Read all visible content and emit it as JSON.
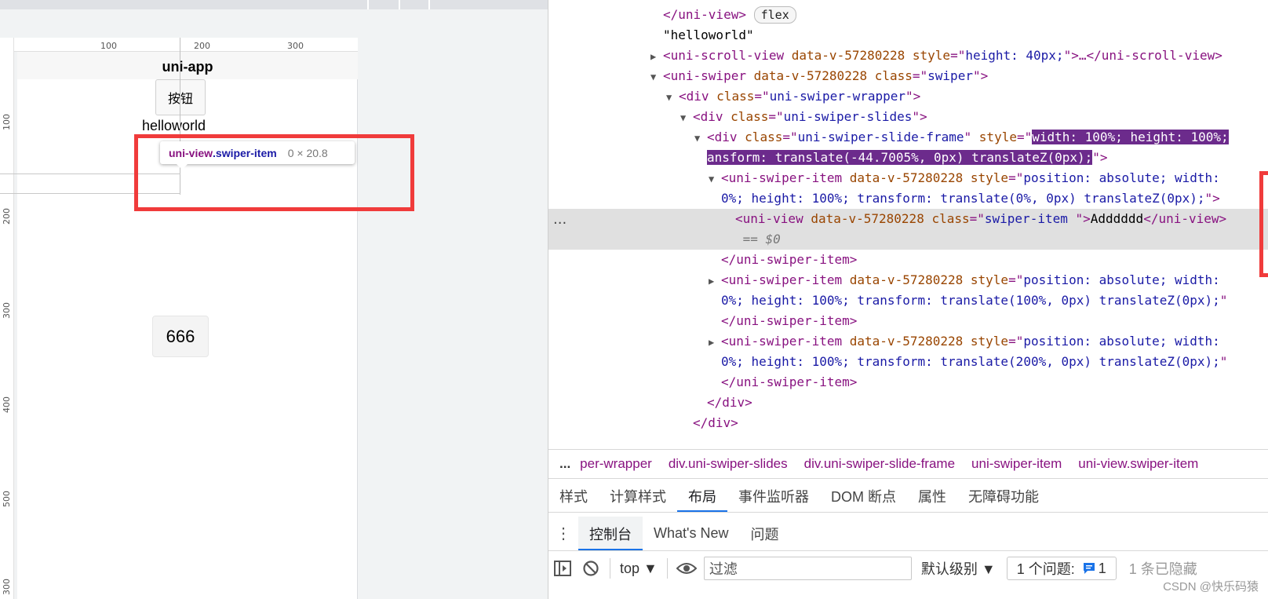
{
  "preview": {
    "ruler_top": [
      "100",
      "200",
      "300"
    ],
    "ruler_left": [
      "100",
      "200",
      "300",
      "400",
      "500",
      "300"
    ],
    "nav_title": "uni-app",
    "button_label": "按钮",
    "hello_text": "helloworld",
    "inspect_tooltip": {
      "tag": "uni-view",
      "class": ".swiper-item",
      "size": "0 × 20.8"
    },
    "card_number": "666"
  },
  "dom": {
    "lines": [
      {
        "indent": 0,
        "tri": "",
        "html": "<span class=\"t\">&lt;/uni-view&gt;</span> <span class=\"pill\">flex</span>"
      },
      {
        "indent": 0,
        "tri": "",
        "html": "<span class=\"s\">\"helloworld\"</span>"
      },
      {
        "indent": 0,
        "tri": "▶",
        "html": "<span class=\"t\">&lt;uni-scroll-view </span><span class=\"a\">data-v-57280228 style</span><span class=\"t\">=\"</span><span class=\"v\">height: 40px;</span><span class=\"t\">\"&gt;…&lt;/uni-scroll-view&gt;</span>"
      },
      {
        "indent": 0,
        "tri": "▼",
        "html": "<span class=\"t\">&lt;uni-swiper </span><span class=\"a\">data-v-57280228 class</span><span class=\"t\">=\"</span><span class=\"v\">swiper</span><span class=\"t\">\"&gt;</span>"
      },
      {
        "indent": 1,
        "tri": "▼",
        "html": "<span class=\"t\">&lt;div </span><span class=\"a\">class</span><span class=\"t\">=\"</span><span class=\"v\">uni-swiper-wrapper</span><span class=\"t\">\"&gt;</span>"
      },
      {
        "indent": 2,
        "tri": "▼",
        "html": "<span class=\"t\">&lt;div </span><span class=\"a\">class</span><span class=\"t\">=\"</span><span class=\"v\">uni-swiper-slides</span><span class=\"t\">\"&gt;</span>"
      },
      {
        "indent": 3,
        "tri": "▼",
        "html": "<span class=\"t\">&lt;div </span><span class=\"a\">class</span><span class=\"t\">=\"</span><span class=\"v\">uni-swiper-slide-frame</span><span class=\"t\">\" </span><span class=\"a\">style</span><span class=\"t\">=\"</span><span class=\"hl\">width: 100%; height: 100%;</span>"
      },
      {
        "indent": 3,
        "tri": "",
        "html": "<span class=\"hl\">ansform: translate(-44.7005%, 0px) translateZ(0px);</span><span class=\"t\">\"&gt;</span>"
      },
      {
        "indent": 4,
        "tri": "▼",
        "html": "<span class=\"t\">&lt;uni-swiper-item </span><span class=\"a\">data-v-57280228 style</span><span class=\"t\">=\"</span><span class=\"v\">position: absolute; width:</span>"
      },
      {
        "indent": 4,
        "tri": "",
        "html": "<span class=\"v\">0%; height: 100%; transform: translate(0%, 0px) translateZ(0px);</span><span class=\"t\">\"&gt;</span>"
      },
      {
        "indent": 5,
        "tri": "",
        "selected": true,
        "html": "<span class=\"t\">&lt;uni-view </span><span class=\"a\">data-v-57280228 class</span><span class=\"t\">=\"</span><span class=\"v\">swiper-item </span><span class=\"t\">\"&gt;</span><span class=\"s\">Adddddd</span><span class=\"t\">&lt;/uni-view&gt;</span>"
      },
      {
        "indent": 5,
        "tri": "",
        "selected": true,
        "html": "<span class=\"eq0\">&nbsp;== $0</span>"
      },
      {
        "indent": 4,
        "tri": "",
        "html": "<span class=\"t\">&lt;/uni-swiper-item&gt;</span>"
      },
      {
        "indent": 4,
        "tri": "▶",
        "html": "<span class=\"t\">&lt;uni-swiper-item </span><span class=\"a\">data-v-57280228 style</span><span class=\"t\">=\"</span><span class=\"v\">position: absolute; width:</span>"
      },
      {
        "indent": 4,
        "tri": "",
        "html": "<span class=\"v\">0%; height: 100%; transform: translate(100%, 0px) translateZ(0px);</span><span class=\"t\">\"</span>"
      },
      {
        "indent": 4,
        "tri": "",
        "html": "<span class=\"t\">&lt;/uni-swiper-item&gt;</span>"
      },
      {
        "indent": 4,
        "tri": "▶",
        "html": "<span class=\"t\">&lt;uni-swiper-item </span><span class=\"a\">data-v-57280228 style</span><span class=\"t\">=\"</span><span class=\"v\">position: absolute; width:</span>"
      },
      {
        "indent": 4,
        "tri": "",
        "html": "<span class=\"v\">0%; height: 100%; transform: translate(200%, 0px) translateZ(0px);</span><span class=\"t\">\"</span>"
      },
      {
        "indent": 4,
        "tri": "",
        "html": "<span class=\"t\">&lt;/uni-swiper-item&gt;</span>"
      },
      {
        "indent": 3,
        "tri": "",
        "html": "<span class=\"t\">&lt;/div&gt;</span>"
      },
      {
        "indent": 2,
        "tri": "",
        "html": "<span class=\"t\">&lt;/div&gt;</span>"
      }
    ]
  },
  "breadcrumbs": {
    "more": "...",
    "items": [
      "per-wrapper",
      "div.uni-swiper-slides",
      "div.uni-swiper-slide-frame",
      "uni-swiper-item",
      "uni-view.swiper-item"
    ]
  },
  "panel_tabs": {
    "items": [
      "样式",
      "计算样式",
      "布局",
      "事件监听器",
      "DOM 断点",
      "属性",
      "无障碍功能"
    ],
    "active": "布局"
  },
  "drawer_tabs": {
    "items": [
      "控制台",
      "What's New",
      "问题"
    ],
    "active": "控制台"
  },
  "console_toolbar": {
    "context": "top",
    "filter_placeholder": "过滤",
    "level": "默认级别",
    "issues_label": "1 个问题:",
    "issues_count": "1",
    "hidden_text": "1 条已隐藏"
  },
  "watermark": "CSDN @快乐码猿",
  "colors": {
    "highlight_red": "#f03b3b",
    "selection_purple": "#6c2b8c",
    "accent_blue": "#1a73e8"
  }
}
